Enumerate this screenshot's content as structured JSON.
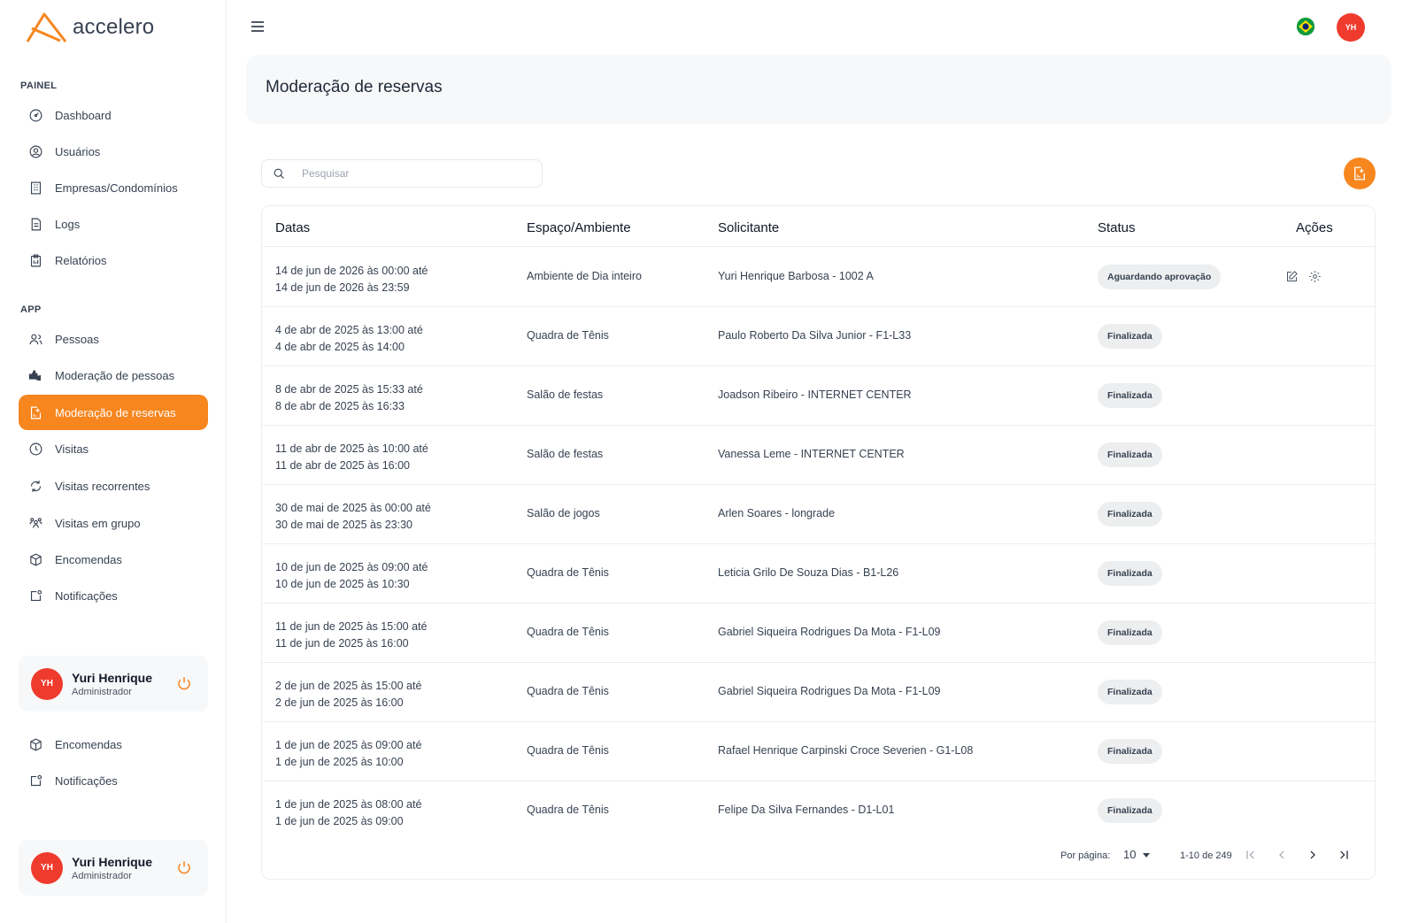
{
  "brand": {
    "name": "accelero",
    "accent": "#f7861f",
    "avatar_color": "#ef3b2d"
  },
  "sidebar": {
    "section_painel": "PAINEL",
    "section_app": "APP",
    "painel_items": [
      {
        "label": "Dashboard",
        "icon": "gauge-icon"
      },
      {
        "label": "Usuários",
        "icon": "user-circle-icon"
      },
      {
        "label": "Empresas/Condomínios",
        "icon": "building-icon"
      },
      {
        "label": "Logs",
        "icon": "document-icon"
      },
      {
        "label": "Relatórios",
        "icon": "clipboard-icon"
      }
    ],
    "app_items": [
      {
        "label": "Pessoas",
        "icon": "people-icon"
      },
      {
        "label": "Moderação de pessoas",
        "icon": "thumbs-icon"
      },
      {
        "label": "Moderação de reservas",
        "icon": "reservation-icon",
        "active": true
      },
      {
        "label": "Visitas",
        "icon": "clock-icon"
      },
      {
        "label": "Visitas recorrentes",
        "icon": "refresh-icon"
      },
      {
        "label": "Visitas em grupo",
        "icon": "group-icon"
      },
      {
        "label": "Encomendas",
        "icon": "package-icon"
      },
      {
        "label": "Notificações",
        "icon": "notification-icon"
      }
    ],
    "extra_items": [
      {
        "label": "Encomendas",
        "icon": "package-icon"
      },
      {
        "label": "Notificações",
        "icon": "notification-icon"
      }
    ],
    "user": {
      "initials": "YH",
      "name": "Yuri Henrique",
      "role": "Administrador"
    }
  },
  "topbar": {
    "avatar_initials": "YH"
  },
  "page": {
    "title": "Moderação de reservas"
  },
  "search": {
    "placeholder": "Pesquisar"
  },
  "table": {
    "headers": {
      "dates": "Datas",
      "space": "Espaço/Ambiente",
      "requester": "Solicitante",
      "status": "Status",
      "actions": "Ações"
    },
    "rows": [
      {
        "start": "14 de jun de 2026 às 00:00 até",
        "end": "14 de jun de 2026 às 23:59",
        "space": "Ambiente de Dia inteiro",
        "requester": "Yuri Henrique Barbosa - 1002 A",
        "status": "Aguardando aprovação",
        "actions": true
      },
      {
        "start": "4 de abr de 2025 às 13:00 até",
        "end": "4 de abr de 2025 às 14:00",
        "space": "Quadra de Tênis",
        "requester": "Paulo Roberto Da Silva Junior - F1-L33",
        "status": "Finalizada"
      },
      {
        "start": "8 de abr de 2025 às 15:33 até",
        "end": "8 de abr de 2025 às 16:33",
        "space": "Salão de festas",
        "requester": "Joadson Ribeiro - INTERNET CENTER",
        "status": "Finalizada"
      },
      {
        "start": "11 de abr de 2025 às 10:00 até",
        "end": "11 de abr de 2025 às 16:00",
        "space": "Salão de festas",
        "requester": "Vanessa Leme - INTERNET CENTER",
        "status": "Finalizada"
      },
      {
        "start": "30 de mai de 2025 às 00:00 até",
        "end": "30 de mai de 2025 às 23:30",
        "space": "Salão de jogos",
        "requester": "Arlen Soares - longrade",
        "status": "Finalizada"
      },
      {
        "start": "10 de jun de 2025 às 09:00 até",
        "end": "10 de jun de 2025 às 10:30",
        "space": "Quadra de Tênis",
        "requester": "Leticia Grilo De Souza Dias - B1-L26",
        "status": "Finalizada"
      },
      {
        "start": "11 de jun de 2025 às 15:00 até",
        "end": "11 de jun de 2025 às 16:00",
        "space": "Quadra de Tênis",
        "requester": "Gabriel Siqueira Rodrigues Da Mota - F1-L09",
        "status": "Finalizada"
      },
      {
        "start": "2 de jun de 2025 às 15:00 até",
        "end": "2 de jun de 2025 às 16:00",
        "space": "Quadra de Tênis",
        "requester": "Gabriel Siqueira Rodrigues Da Mota - F1-L09",
        "status": "Finalizada"
      },
      {
        "start": "1 de jun de 2025 às 09:00 até",
        "end": "1 de jun de 2025 às 10:00",
        "space": "Quadra de Tênis",
        "requester": "Rafael Henrique Carpinski Croce Severien - G1-L08",
        "status": "Finalizada"
      },
      {
        "start": "1 de jun de 2025 às 08:00 até",
        "end": "1 de jun de 2025 às 09:00",
        "space": "Quadra de Tênis",
        "requester": "Felipe Da Silva Fernandes - D1-L01",
        "status": "Finalizada"
      }
    ]
  },
  "pagination": {
    "per_page_label": "Por página:",
    "per_page": "10",
    "range": "1-10 de 249"
  }
}
